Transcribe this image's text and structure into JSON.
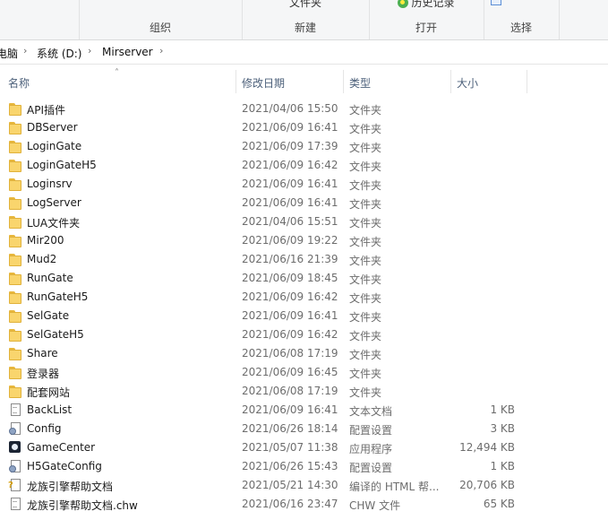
{
  "ribbon": {
    "groups": [
      {
        "label": "组织"
      },
      {
        "label": "新建",
        "top_text": "文件夹"
      },
      {
        "label": "打开",
        "top_text": "历史记录"
      },
      {
        "label": "选择"
      }
    ]
  },
  "address": {
    "crumbs": [
      "电脑",
      "系统 (D:)",
      "Mirserver"
    ]
  },
  "columns": {
    "name": "名称",
    "date": "修改日期",
    "type": "类型",
    "size": "大小"
  },
  "files": [
    {
      "name": "API插件",
      "date": "2021/04/06 15:50",
      "type": "文件夹",
      "size": "",
      "icon": "folder-icon"
    },
    {
      "name": "DBServer",
      "date": "2021/06/09 16:41",
      "type": "文件夹",
      "size": "",
      "icon": "folder-icon"
    },
    {
      "name": "LoginGate",
      "date": "2021/06/09 17:39",
      "type": "文件夹",
      "size": "",
      "icon": "folder-icon"
    },
    {
      "name": "LoginGateH5",
      "date": "2021/06/09 16:42",
      "type": "文件夹",
      "size": "",
      "icon": "folder-icon"
    },
    {
      "name": "Loginsrv",
      "date": "2021/06/09 16:41",
      "type": "文件夹",
      "size": "",
      "icon": "folder-icon"
    },
    {
      "name": "LogServer",
      "date": "2021/06/09 16:41",
      "type": "文件夹",
      "size": "",
      "icon": "folder-icon"
    },
    {
      "name": "LUA文件夹",
      "date": "2021/04/06 15:51",
      "type": "文件夹",
      "size": "",
      "icon": "folder-icon"
    },
    {
      "name": "Mir200",
      "date": "2021/06/09 19:22",
      "type": "文件夹",
      "size": "",
      "icon": "folder-icon"
    },
    {
      "name": "Mud2",
      "date": "2021/06/16 21:39",
      "type": "文件夹",
      "size": "",
      "icon": "folder-icon"
    },
    {
      "name": "RunGate",
      "date": "2021/06/09 18:45",
      "type": "文件夹",
      "size": "",
      "icon": "folder-icon"
    },
    {
      "name": "RunGateH5",
      "date": "2021/06/09 16:42",
      "type": "文件夹",
      "size": "",
      "icon": "folder-icon"
    },
    {
      "name": "SelGate",
      "date": "2021/06/09 16:41",
      "type": "文件夹",
      "size": "",
      "icon": "folder-icon"
    },
    {
      "name": "SelGateH5",
      "date": "2021/06/09 16:42",
      "type": "文件夹",
      "size": "",
      "icon": "folder-icon"
    },
    {
      "name": "Share",
      "date": "2021/06/08 17:19",
      "type": "文件夹",
      "size": "",
      "icon": "folder-icon"
    },
    {
      "name": "登录器",
      "date": "2021/06/09 16:45",
      "type": "文件夹",
      "size": "",
      "icon": "folder-icon"
    },
    {
      "name": "配套网站",
      "date": "2021/06/08 17:19",
      "type": "文件夹",
      "size": "",
      "icon": "folder-icon"
    },
    {
      "name": "BackList",
      "date": "2021/06/09 16:41",
      "type": "文本文档",
      "size": "1 KB",
      "icon": "text-document-icon"
    },
    {
      "name": "Config",
      "date": "2021/06/26 18:14",
      "type": "配置设置",
      "size": "3 KB",
      "icon": "config-file-icon"
    },
    {
      "name": "GameCenter",
      "date": "2021/05/07 11:38",
      "type": "应用程序",
      "size": "12,494 KB",
      "icon": "application-icon"
    },
    {
      "name": "H5GateConfig",
      "date": "2021/06/26 15:43",
      "type": "配置设置",
      "size": "1 KB",
      "icon": "config-file-icon"
    },
    {
      "name": "龙族引擎帮助文档",
      "date": "2021/05/21 14:30",
      "type": "编译的 HTML 帮...",
      "size": "20,706 KB",
      "icon": "help-file-icon"
    },
    {
      "name": "龙族引擎帮助文档.chw",
      "date": "2021/06/16 23:47",
      "type": "CHW 文件",
      "size": "65 KB",
      "icon": "text-document-icon"
    }
  ]
}
